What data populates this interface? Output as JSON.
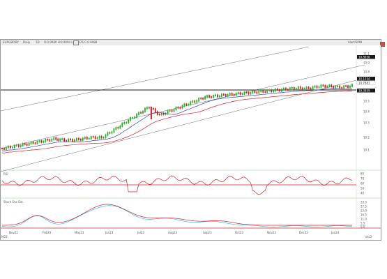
{
  "toolbar": {
    "symbol": "EURGBP/BY",
    "timeframe": "Daily",
    "period": "1D",
    "ohlc": "O:0.9080 H:0.9094 L:0.9076 C:0.9088",
    "right_label": "Alert/SPIN",
    "buttons": [
      "restore-icon",
      "maximize-icon",
      "close-icon"
    ]
  },
  "price_labels": [
    {
      "text": "10.8056",
      "style": "dark"
    },
    {
      "text": "10.1234",
      "style": "dark"
    },
    {
      "text": "10.7881",
      "style": "plain"
    },
    {
      "text": "10.3939",
      "style": "dark"
    }
  ],
  "axis": {
    "price_ticks": [
      "11.1",
      "10.9",
      "10.8",
      "10.7",
      "10.5",
      "10.4",
      "10.3",
      "10.2",
      "10.1"
    ],
    "rsi_ticks": [
      "80",
      "70",
      "60",
      "50",
      "40"
    ],
    "stoch_ticks": [
      "33.0",
      "27.5",
      "22.0",
      "16.5",
      "11.0",
      "5.5",
      "0.0"
    ],
    "dates": [
      "Nov22",
      "Feb23",
      "May23",
      "Jun23",
      "Jul23",
      "Aug23",
      "Sep23",
      "Oct23",
      "Nov23",
      "Dec23",
      "Jan24"
    ],
    "corner": "ok.D",
    "timeline_start": "M23"
  },
  "panes": {
    "rsi_label": "RSI",
    "stoch_label": "Stoch Osc Ext."
  },
  "colors": {
    "bull": "#22b322",
    "bear": "#d02020",
    "ma_fast": "#d21e2a",
    "ma_slow": "#2a42c8",
    "channel": "#6a6a6a",
    "rsi": "#d21e2a",
    "stoch_k": "#d21e2a",
    "stoch_d": "#2fbfe8",
    "hline": "#1a1a1a"
  }
}
